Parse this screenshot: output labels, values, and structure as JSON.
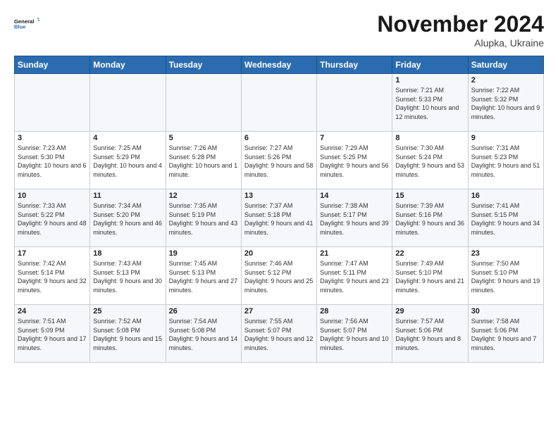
{
  "header": {
    "logo_line1": "General",
    "logo_line2": "Blue",
    "month": "November 2024",
    "location": "Alupka, Ukraine"
  },
  "days_of_week": [
    "Sunday",
    "Monday",
    "Tuesday",
    "Wednesday",
    "Thursday",
    "Friday",
    "Saturday"
  ],
  "weeks": [
    [
      {
        "day": "",
        "info": ""
      },
      {
        "day": "",
        "info": ""
      },
      {
        "day": "",
        "info": ""
      },
      {
        "day": "",
        "info": ""
      },
      {
        "day": "",
        "info": ""
      },
      {
        "day": "1",
        "info": "Sunrise: 7:21 AM\nSunset: 5:33 PM\nDaylight: 10 hours and 12 minutes."
      },
      {
        "day": "2",
        "info": "Sunrise: 7:22 AM\nSunset: 5:32 PM\nDaylight: 10 hours and 9 minutes."
      }
    ],
    [
      {
        "day": "3",
        "info": "Sunrise: 7:23 AM\nSunset: 5:30 PM\nDaylight: 10 hours and 6 minutes."
      },
      {
        "day": "4",
        "info": "Sunrise: 7:25 AM\nSunset: 5:29 PM\nDaylight: 10 hours and 4 minutes."
      },
      {
        "day": "5",
        "info": "Sunrise: 7:26 AM\nSunset: 5:28 PM\nDaylight: 10 hours and 1 minute."
      },
      {
        "day": "6",
        "info": "Sunrise: 7:27 AM\nSunset: 5:26 PM\nDaylight: 9 hours and 58 minutes."
      },
      {
        "day": "7",
        "info": "Sunrise: 7:29 AM\nSunset: 5:25 PM\nDaylight: 9 hours and 56 minutes."
      },
      {
        "day": "8",
        "info": "Sunrise: 7:30 AM\nSunset: 5:24 PM\nDaylight: 9 hours and 53 minutes."
      },
      {
        "day": "9",
        "info": "Sunrise: 7:31 AM\nSunset: 5:23 PM\nDaylight: 9 hours and 51 minutes."
      }
    ],
    [
      {
        "day": "10",
        "info": "Sunrise: 7:33 AM\nSunset: 5:22 PM\nDaylight: 9 hours and 48 minutes."
      },
      {
        "day": "11",
        "info": "Sunrise: 7:34 AM\nSunset: 5:20 PM\nDaylight: 9 hours and 46 minutes."
      },
      {
        "day": "12",
        "info": "Sunrise: 7:35 AM\nSunset: 5:19 PM\nDaylight: 9 hours and 43 minutes."
      },
      {
        "day": "13",
        "info": "Sunrise: 7:37 AM\nSunset: 5:18 PM\nDaylight: 9 hours and 41 minutes."
      },
      {
        "day": "14",
        "info": "Sunrise: 7:38 AM\nSunset: 5:17 PM\nDaylight: 9 hours and 39 minutes."
      },
      {
        "day": "15",
        "info": "Sunrise: 7:39 AM\nSunset: 5:16 PM\nDaylight: 9 hours and 36 minutes."
      },
      {
        "day": "16",
        "info": "Sunrise: 7:41 AM\nSunset: 5:15 PM\nDaylight: 9 hours and 34 minutes."
      }
    ],
    [
      {
        "day": "17",
        "info": "Sunrise: 7:42 AM\nSunset: 5:14 PM\nDaylight: 9 hours and 32 minutes."
      },
      {
        "day": "18",
        "info": "Sunrise: 7:43 AM\nSunset: 5:13 PM\nDaylight: 9 hours and 30 minutes."
      },
      {
        "day": "19",
        "info": "Sunrise: 7:45 AM\nSunset: 5:13 PM\nDaylight: 9 hours and 27 minutes."
      },
      {
        "day": "20",
        "info": "Sunrise: 7:46 AM\nSunset: 5:12 PM\nDaylight: 9 hours and 25 minutes."
      },
      {
        "day": "21",
        "info": "Sunrise: 7:47 AM\nSunset: 5:11 PM\nDaylight: 9 hours and 23 minutes."
      },
      {
        "day": "22",
        "info": "Sunrise: 7:49 AM\nSunset: 5:10 PM\nDaylight: 9 hours and 21 minutes."
      },
      {
        "day": "23",
        "info": "Sunrise: 7:50 AM\nSunset: 5:10 PM\nDaylight: 9 hours and 19 minutes."
      }
    ],
    [
      {
        "day": "24",
        "info": "Sunrise: 7:51 AM\nSunset: 5:09 PM\nDaylight: 9 hours and 17 minutes."
      },
      {
        "day": "25",
        "info": "Sunrise: 7:52 AM\nSunset: 5:08 PM\nDaylight: 9 hours and 15 minutes."
      },
      {
        "day": "26",
        "info": "Sunrise: 7:54 AM\nSunset: 5:08 PM\nDaylight: 9 hours and 14 minutes."
      },
      {
        "day": "27",
        "info": "Sunrise: 7:55 AM\nSunset: 5:07 PM\nDaylight: 9 hours and 12 minutes."
      },
      {
        "day": "28",
        "info": "Sunrise: 7:56 AM\nSunset: 5:07 PM\nDaylight: 9 hours and 10 minutes."
      },
      {
        "day": "29",
        "info": "Sunrise: 7:57 AM\nSunset: 5:06 PM\nDaylight: 9 hours and 8 minutes."
      },
      {
        "day": "30",
        "info": "Sunrise: 7:58 AM\nSunset: 5:06 PM\nDaylight: 9 hours and 7 minutes."
      }
    ]
  ]
}
